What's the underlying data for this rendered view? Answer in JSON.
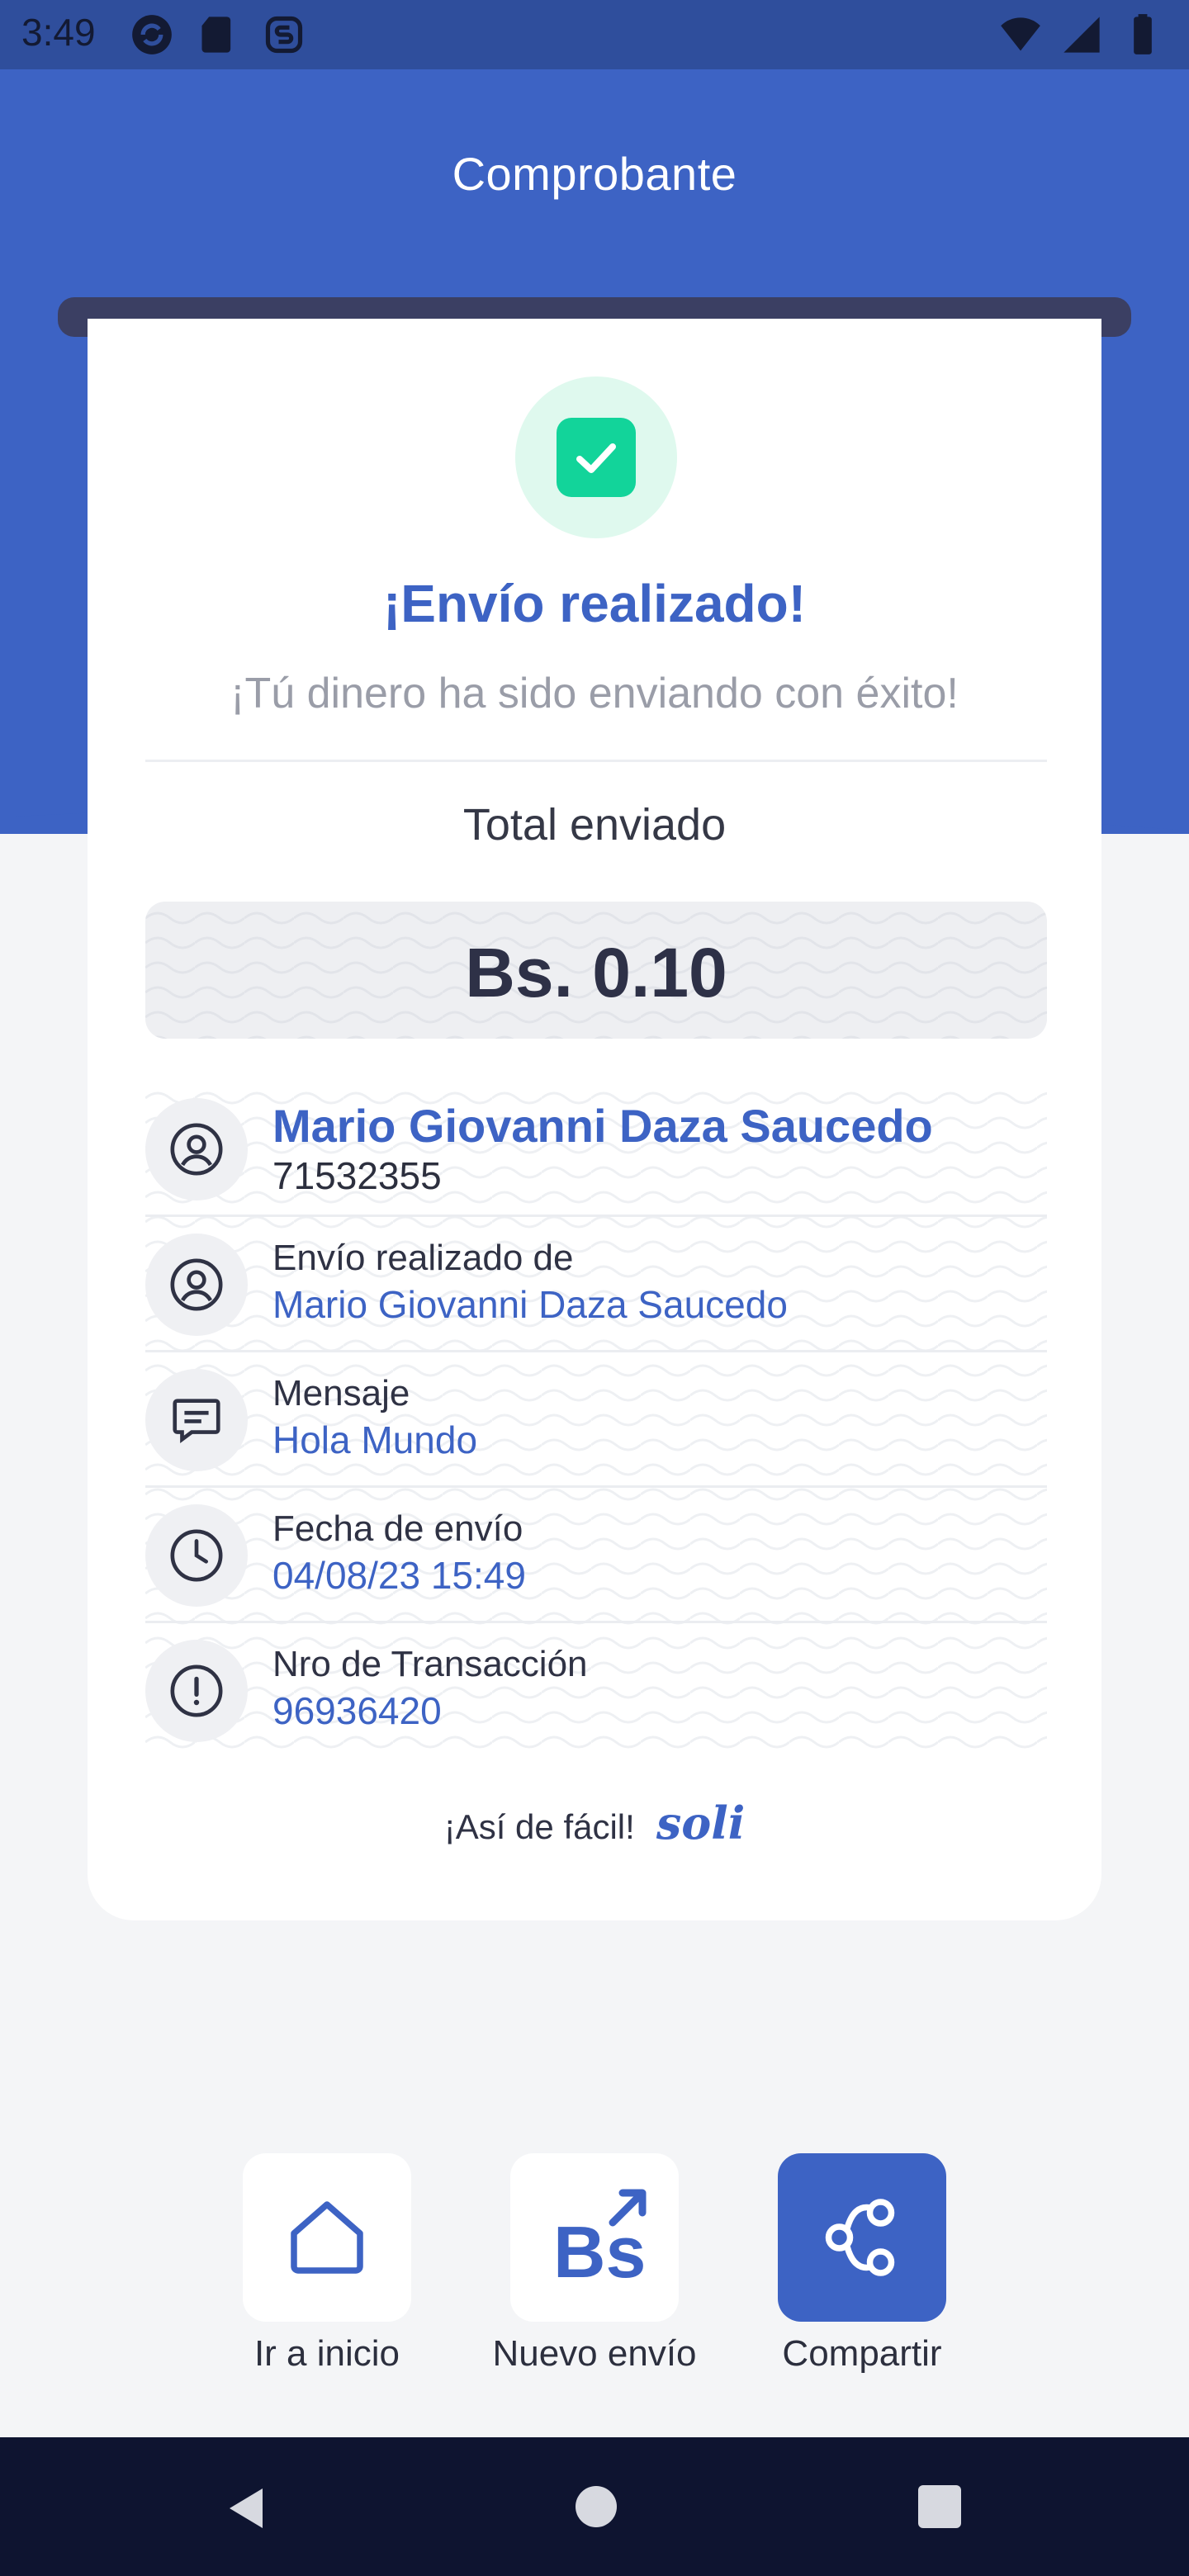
{
  "status_bar": {
    "time": "3:49"
  },
  "header": {
    "title": "Comprobante"
  },
  "receipt": {
    "heading": "¡Envío realizado!",
    "subtitle": "¡Tú dinero ha sido enviando con éxito!",
    "total_label": "Total enviado",
    "amount": "Bs. 0.10",
    "recipient": {
      "name": "Mario Giovanni Daza Saucedo",
      "phone": "71532355",
      "icon": "user-circle-icon"
    },
    "sender": {
      "label": "Envío realizado de",
      "value": "Mario Giovanni Daza Saucedo",
      "icon": "user-circle-icon"
    },
    "message": {
      "label": "Mensaje",
      "value": "Hola Mundo",
      "icon": "message-icon"
    },
    "date": {
      "label": "Fecha de envío",
      "value": "04/08/23 15:49",
      "icon": "clock-icon"
    },
    "transaction": {
      "label": "Nro de Transacción",
      "value": "96936420",
      "icon": "alert-circle-icon"
    },
    "tagline": "¡Así de fácil!",
    "brand": "soli"
  },
  "actions": {
    "home_label": "Ir a inicio",
    "new_transfer_label": "Nuevo envío",
    "new_transfer_glyph": "Bs",
    "share_label": "Compartir"
  },
  "colors": {
    "primary": "#3d63c4",
    "success": "#12d49a",
    "success_bg": "#dff9ee",
    "dark_navy": "#0e1430"
  }
}
